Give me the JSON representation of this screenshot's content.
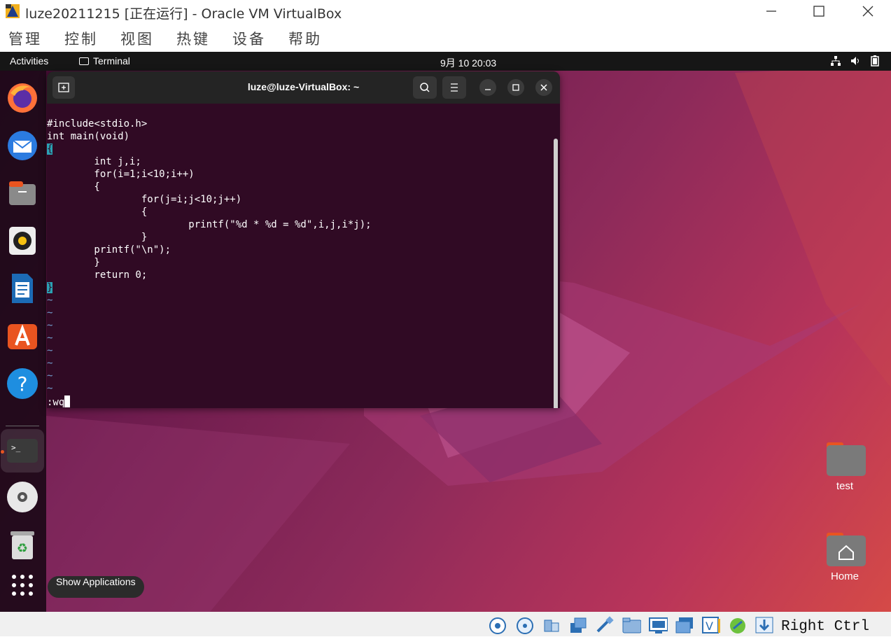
{
  "host_window": {
    "title": "luze20211215 [正在运行] - Oracle VM VirtualBox",
    "menu": [
      "管理",
      "控制",
      "视图",
      "热键",
      "设备",
      "帮助"
    ]
  },
  "guest": {
    "topbar": {
      "activities": "Activities",
      "focused_app": "Terminal",
      "clock": "9月 10  20:03",
      "status_icons": [
        "network-icon",
        "volume-icon",
        "battery-icon"
      ]
    },
    "dock": {
      "items": [
        "firefox-icon",
        "thunderbird-icon",
        "files-icon",
        "rhythmbox-icon",
        "libreoffice-writer-icon",
        "software-center-icon",
        "help-icon",
        "terminal-icon",
        "optical-disc-icon",
        "trash-icon"
      ],
      "show_apps_tooltip": "Show Applications"
    },
    "terminal": {
      "title": "luze@luze-VirtualBox: ~",
      "code_lines": [
        "#include<stdio.h>",
        "int main(void)",
        "{",
        "        int j,i;",
        "        for(i=1;i<10;i++)",
        "        {",
        "                for(j=i;j<10;j++)",
        "                {",
        "                        printf(\"%d * %d = %d\",i,j,i*j);",
        "                }",
        "        printf(\"\\n\");",
        "        }",
        "        return 0;",
        "}"
      ],
      "tilde_count": 8,
      "tilde": "~",
      "command": ":wq"
    },
    "desktop_icons": [
      {
        "label": "test",
        "icon": "folder-icon"
      },
      {
        "label": "Home",
        "icon": "home-folder-icon"
      }
    ]
  },
  "status_bar": {
    "host_key": "Right Ctrl"
  }
}
